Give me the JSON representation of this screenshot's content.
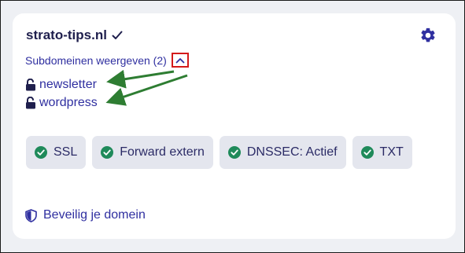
{
  "domain": {
    "name": "strato-tips.nl"
  },
  "subdomains": {
    "toggle_label": "Subdomeinen weergeven (2)",
    "items": [
      {
        "label": "newsletter",
        "icon": "lock-open-icon"
      },
      {
        "label": "wordpress",
        "icon": "lock-open-icon"
      }
    ]
  },
  "badges": [
    {
      "label": "SSL",
      "icon": "check-circle-icon"
    },
    {
      "label": "Forward extern",
      "icon": "check-circle-icon"
    },
    {
      "label": "DNSSEC: Actief",
      "icon": "check-circle-icon"
    },
    {
      "label": "TXT",
      "icon": "check-circle-icon"
    }
  ],
  "security_link": {
    "label": "Beveilig je domein",
    "icon": "shield-icon"
  },
  "colors": {
    "accent": "#2f2fa0",
    "badge_check": "#1f8a5a",
    "highlight_border": "#d41a1a",
    "annotation_arrow": "#2e7d32",
    "badge_bg": "#e4e6ee",
    "page_bg": "#eef0f4"
  }
}
